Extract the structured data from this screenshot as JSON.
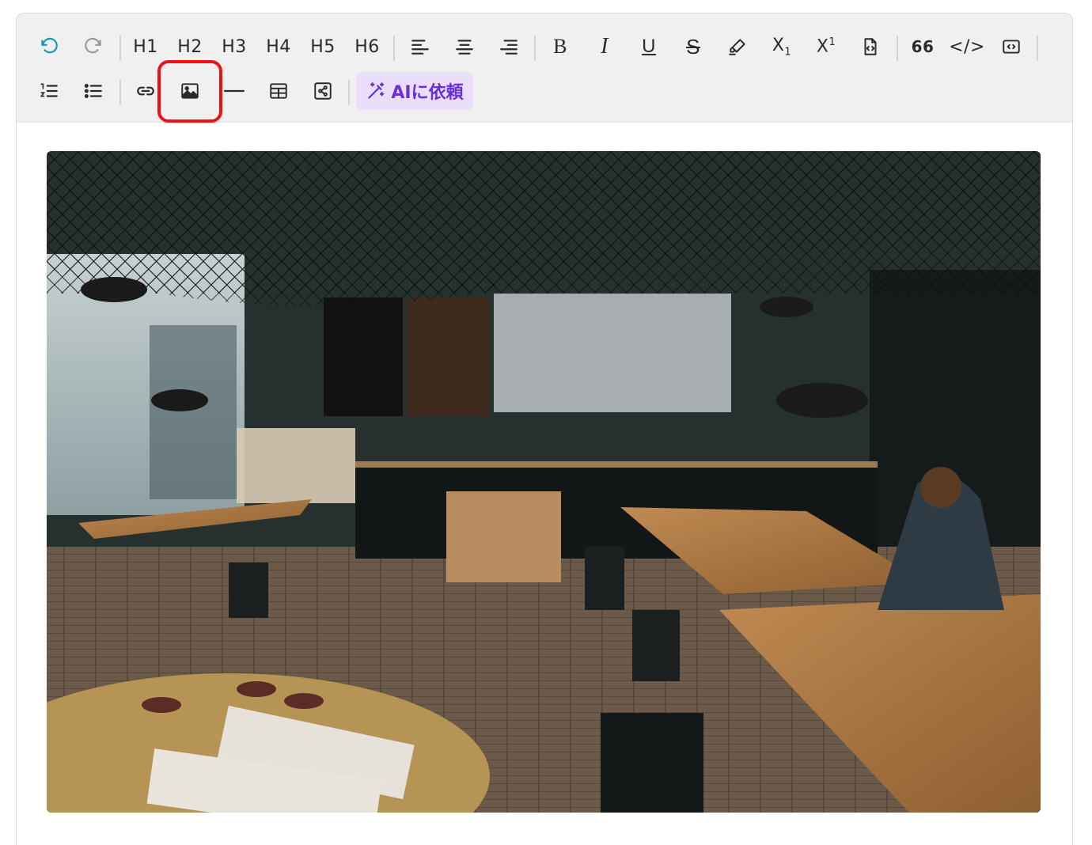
{
  "toolbar": {
    "headings": [
      "H1",
      "H2",
      "H3",
      "H4",
      "H5",
      "H6"
    ],
    "bold_label": "B",
    "italic_label": "I",
    "underline_label": "U",
    "strike_label": "S",
    "subscript": {
      "base": "X",
      "sub": "1"
    },
    "superscript": {
      "base": "X",
      "sup": "1"
    },
    "blockquote_label": "66",
    "code_label": "</>",
    "ai_label": "AIに依頼",
    "accent_color": "#6a2fd8",
    "ai_bg_color": "#ebdefb",
    "highlight_color": "#ee1111",
    "icons": {
      "undo": "undo-icon",
      "redo": "redo-icon",
      "align_left": "align-left-icon",
      "align_center": "align-center-icon",
      "align_right": "align-right-icon",
      "highlight": "highlighter-icon",
      "doc_code": "file-code-icon",
      "code_block": "code-block-icon",
      "ordered_list": "ordered-list-icon",
      "bullet_list": "bullet-list-icon",
      "link": "link-icon",
      "image": "image-icon",
      "hr": "horizontal-rule-icon",
      "table": "table-icon",
      "embed": "share-embed-icon",
      "ai": "magic-wand-icon"
    }
  },
  "content": {
    "image_subject": "cafe-interior"
  }
}
